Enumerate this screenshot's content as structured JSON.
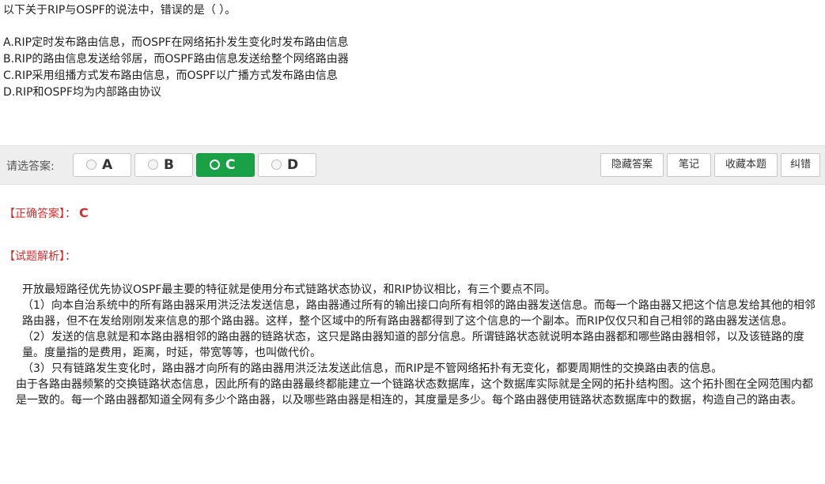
{
  "question": {
    "title": "以下关于RIP与OSPF的说法中，错误的是（ ）。",
    "options": [
      "A.RIP定时发布路由信息，而OSPF在网络拓扑发生变化时发布路由信息",
      "B.RIP的路由信息发送给邻居，而OSPF路由信息发送给整个网络路由器",
      "C.RIP采用组播方式发布路由信息，而OSPF以广播方式发布路由信息",
      "D.RIP和OSPF均为内部路由协议"
    ]
  },
  "answer_bar": {
    "label": "请选答案:",
    "choices": [
      "A",
      "B",
      "C",
      "D"
    ],
    "selected": "C",
    "selected_color": "#1ba145",
    "tools": [
      "隐藏答案",
      "笔记",
      "收藏本题",
      "纠错"
    ]
  },
  "result": {
    "correct_label": "【正确答案】：",
    "correct_value": "C",
    "analysis_label": "【试题解析】：",
    "accent_color": "#d32f2f"
  },
  "analysis": [
    "开放最短路径优先协议OSPF最主要的特征就是使用分布式链路状态协议，和RIP协议相比，有三个要点不同。",
    "（1）向本自治系统中的所有路由器采用洪泛法发送信息，路由器通过所有的输出接口向所有相邻的路由器发送信息。而每一个路由器又把这个信息发给其他的相邻路由器，但不在发给刚刚发来信息的那个路由器。这样，整个区域中的所有路由器都得到了这个信息的一个副本。而RIP仅仅只和自己相邻的路由器发送信息。",
    "（2）发送的信息就是和本路由器相邻的路由器的链路状态，这只是路由器知道的部分信息。所谓链路状态就说明本路由器都和哪些路由器相邻，以及该链路的度量。度量指的是费用，距离，时延，带宽等等，也叫做代价。",
    "（3）只有链路发生变化时，路由器才向所有的路由器用洪泛法发送此信息，而RIP是不管网络拓扑有无变化，都要周期性的交换路由表的信息。",
    "由于各路由器频繁的交换链路状态信息，因此所有的路由器最终都能建立一个链路状态数据库，这个数据库实际就是全网的拓扑结构图。这个拓扑图在全网范围内都是一致的。每一个路由器都知道全网有多少个路由器，以及哪些路由器是相连的，其度量是多少。每个路由器使用链路状态数据库中的数据，构造自己的路由表。"
  ]
}
